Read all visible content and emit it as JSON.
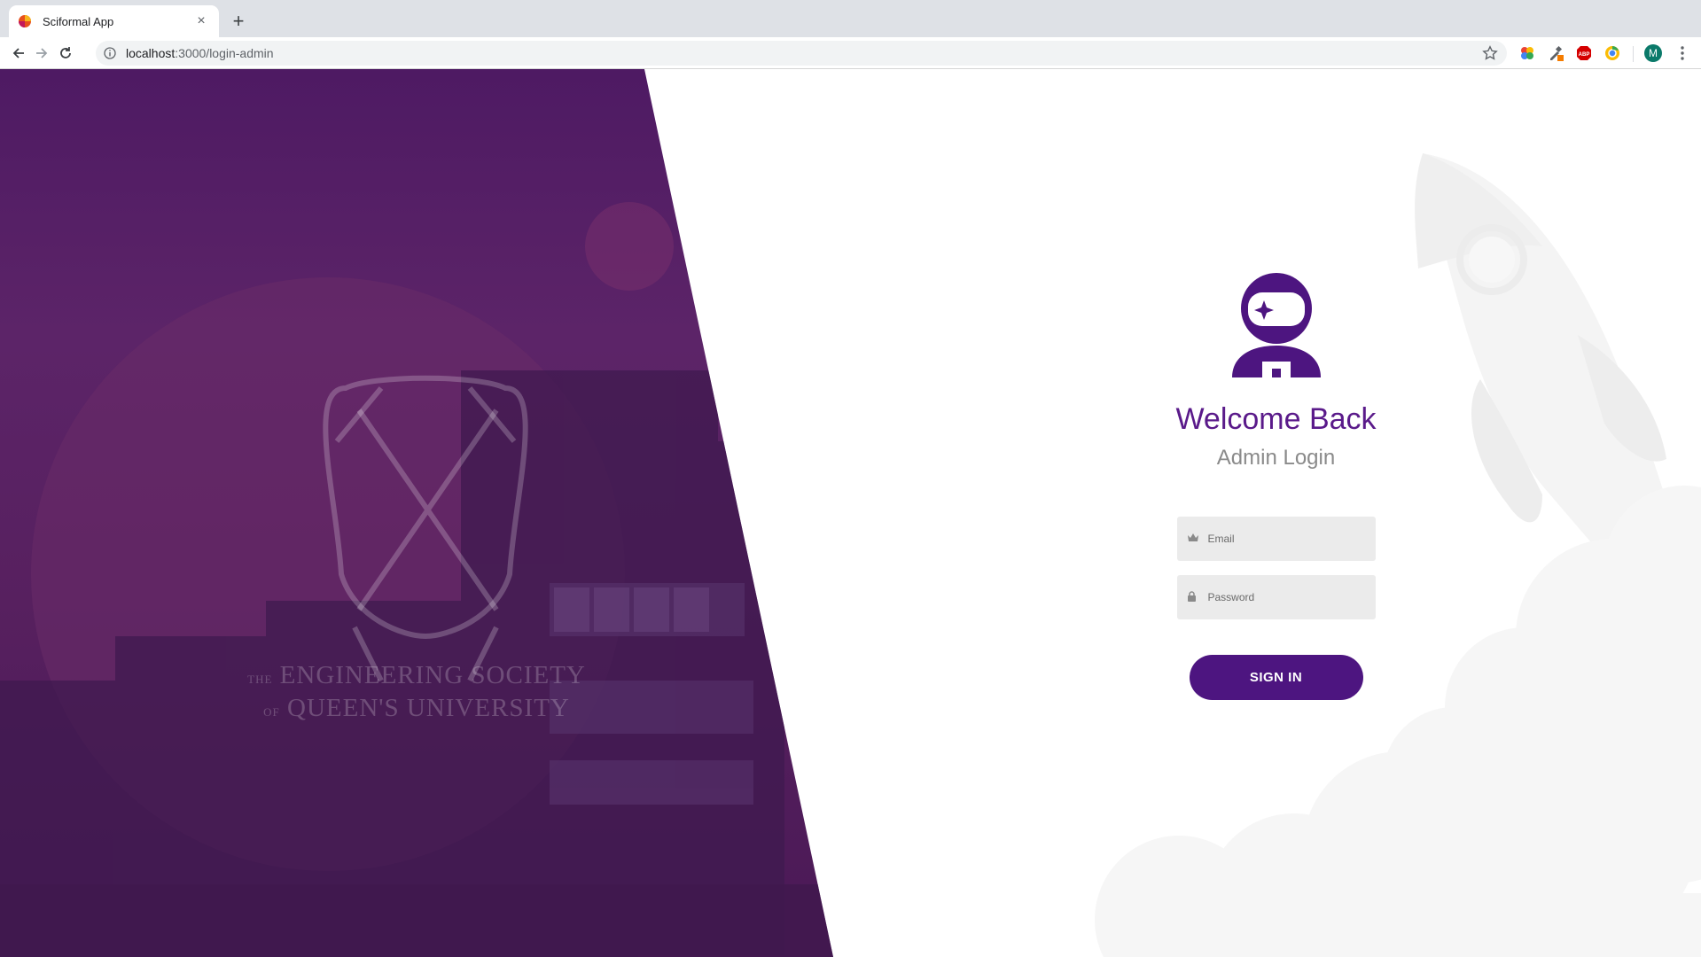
{
  "browser": {
    "tab_title": "Sciformal App",
    "tab_close": "×",
    "new_tab": "+",
    "url_host": "localhost",
    "url_rest": ":3000/login-admin",
    "profile_initial": "M"
  },
  "background": {
    "crest_line1_prefix": "THE",
    "crest_line1": "ENGINEERING SOCIETY",
    "crest_line2_prefix": "OF",
    "crest_line2": "QUEEN'S UNIVERSITY"
  },
  "login": {
    "title": "Welcome Back",
    "subtitle": "Admin Login",
    "email_placeholder": "Email",
    "password_placeholder": "Password",
    "signin_label": "SIGN IN"
  },
  "colors": {
    "brand_purple": "#4d1580",
    "title_purple": "#5a1a8a",
    "panel_purple": "#57205f",
    "input_bg": "#ebebeb"
  },
  "icons": [
    "tab-favicon",
    "close-icon",
    "plus-icon",
    "back-arrow-icon",
    "forward-arrow-icon",
    "reload-icon",
    "info-icon",
    "star-icon",
    "astronaut-icon",
    "crown-icon",
    "lock-icon",
    "rocket-icon",
    "clouds-icon",
    "crest-icon"
  ]
}
